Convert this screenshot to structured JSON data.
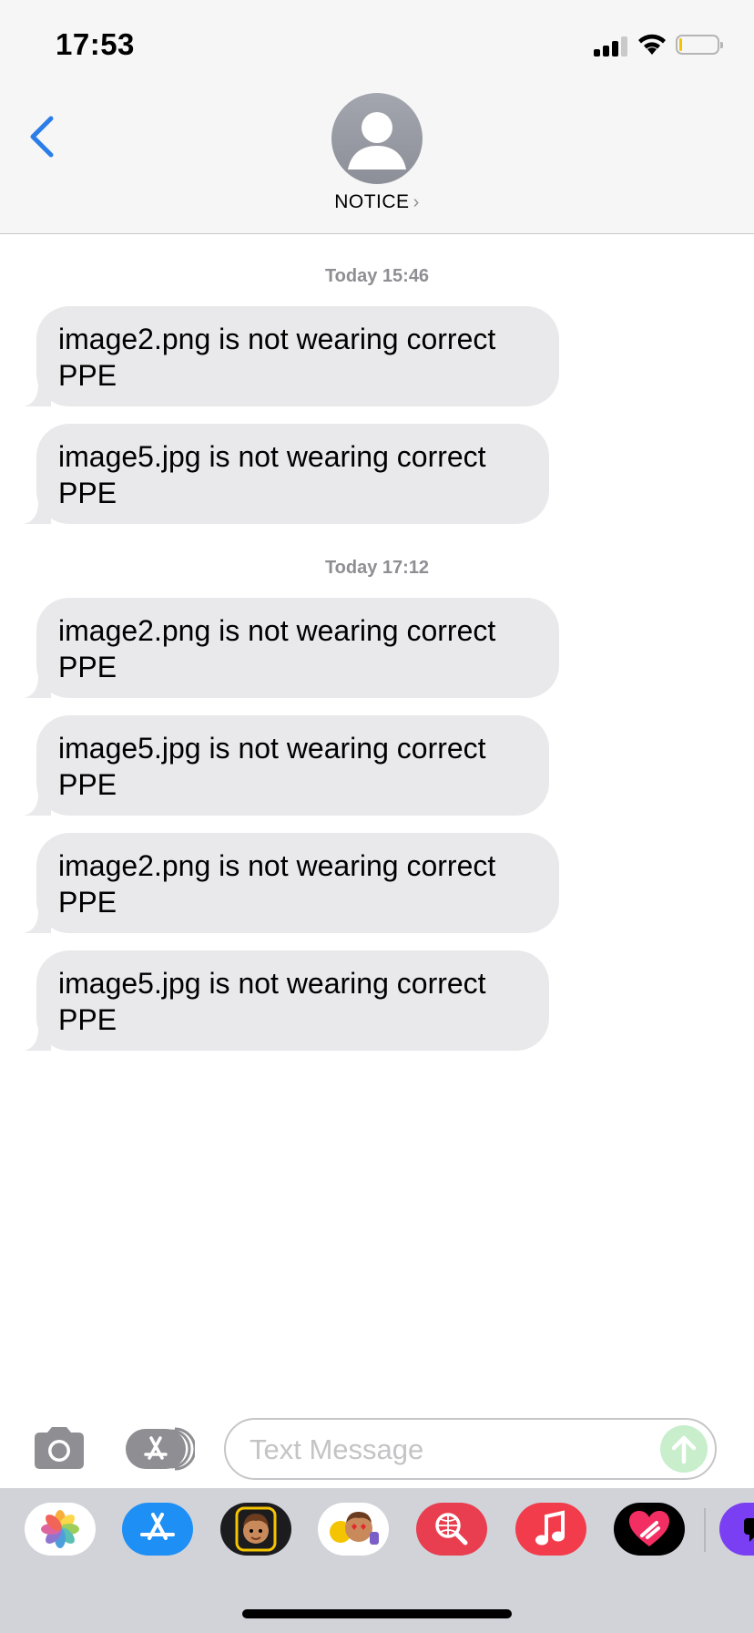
{
  "status_bar": {
    "time": "17:53"
  },
  "header": {
    "contact_name": "NOTICE",
    "chevron": "›"
  },
  "messages": {
    "groups": [
      {
        "timestamp": "Today 15:46",
        "bubbles": [
          {
            "line1": "image2.png is not wearing correct",
            "line2": "PPE"
          },
          {
            "line1": "image5.jpg is not wearing correct",
            "line2": "PPE"
          }
        ]
      },
      {
        "timestamp": "Today 17:12",
        "bubbles": [
          {
            "line1": "image2.png is not wearing correct",
            "line2": "PPE"
          },
          {
            "line1": "image5.jpg is not wearing correct",
            "line2": "PPE"
          },
          {
            "line1": "image2.png is not wearing correct",
            "line2": "PPE"
          },
          {
            "line1": "image5.jpg is not wearing correct",
            "line2": "PPE"
          }
        ]
      }
    ]
  },
  "input": {
    "placeholder": "Text Message"
  },
  "drawer": {
    "apps": [
      "photos-icon",
      "app-store-icon",
      "memoji-icon",
      "animoji-stickers-icon",
      "web-search-icon",
      "music-icon",
      "digital-touch-icon",
      "more-apps-icon"
    ]
  },
  "colors": {
    "accent": "#2b7de9",
    "bubble": "#e9e9eb",
    "send": "#c8eecc",
    "drawer": "#d1d3d9"
  }
}
